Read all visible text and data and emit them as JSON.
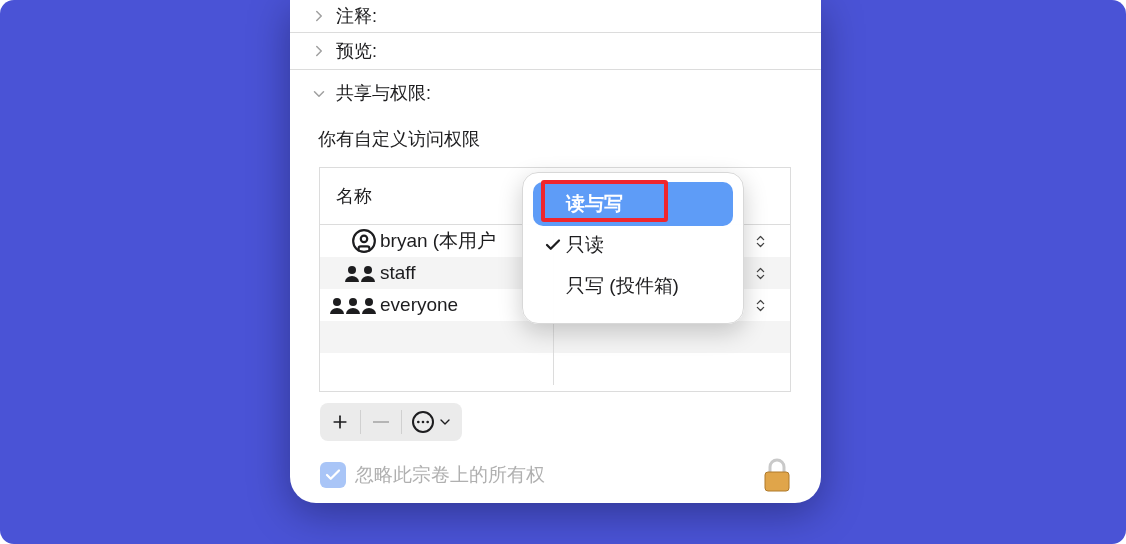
{
  "sections": [
    {
      "label": "注释:",
      "expanded": false
    },
    {
      "label": "预览:",
      "expanded": false
    },
    {
      "label": "共享与权限:",
      "expanded": true
    }
  ],
  "description": "你有自定义访问权限",
  "table": {
    "columns": [
      "名称"
    ],
    "rows": [
      {
        "name": "bryan (本用户",
        "kind": "user"
      },
      {
        "name": "staff",
        "kind": "group"
      },
      {
        "name": "everyone",
        "kind": "everyone"
      }
    ]
  },
  "menu": [
    {
      "label": "读与写",
      "checked": false,
      "highlighted": true,
      "annotated": true
    },
    {
      "label": "只读",
      "checked": true,
      "highlighted": false,
      "annotated": false
    },
    {
      "label": "只写 (投件箱)",
      "checked": false,
      "highlighted": false,
      "annotated": false
    }
  ],
  "toolbar": [
    {
      "kind": "add",
      "disabled": false
    },
    {
      "kind": "remove",
      "disabled": true
    },
    {
      "kind": "more",
      "disabled": false
    }
  ],
  "ignore_ownership": {
    "label": "忽略此宗卷上的所有权",
    "checked": true,
    "disabled": true
  }
}
